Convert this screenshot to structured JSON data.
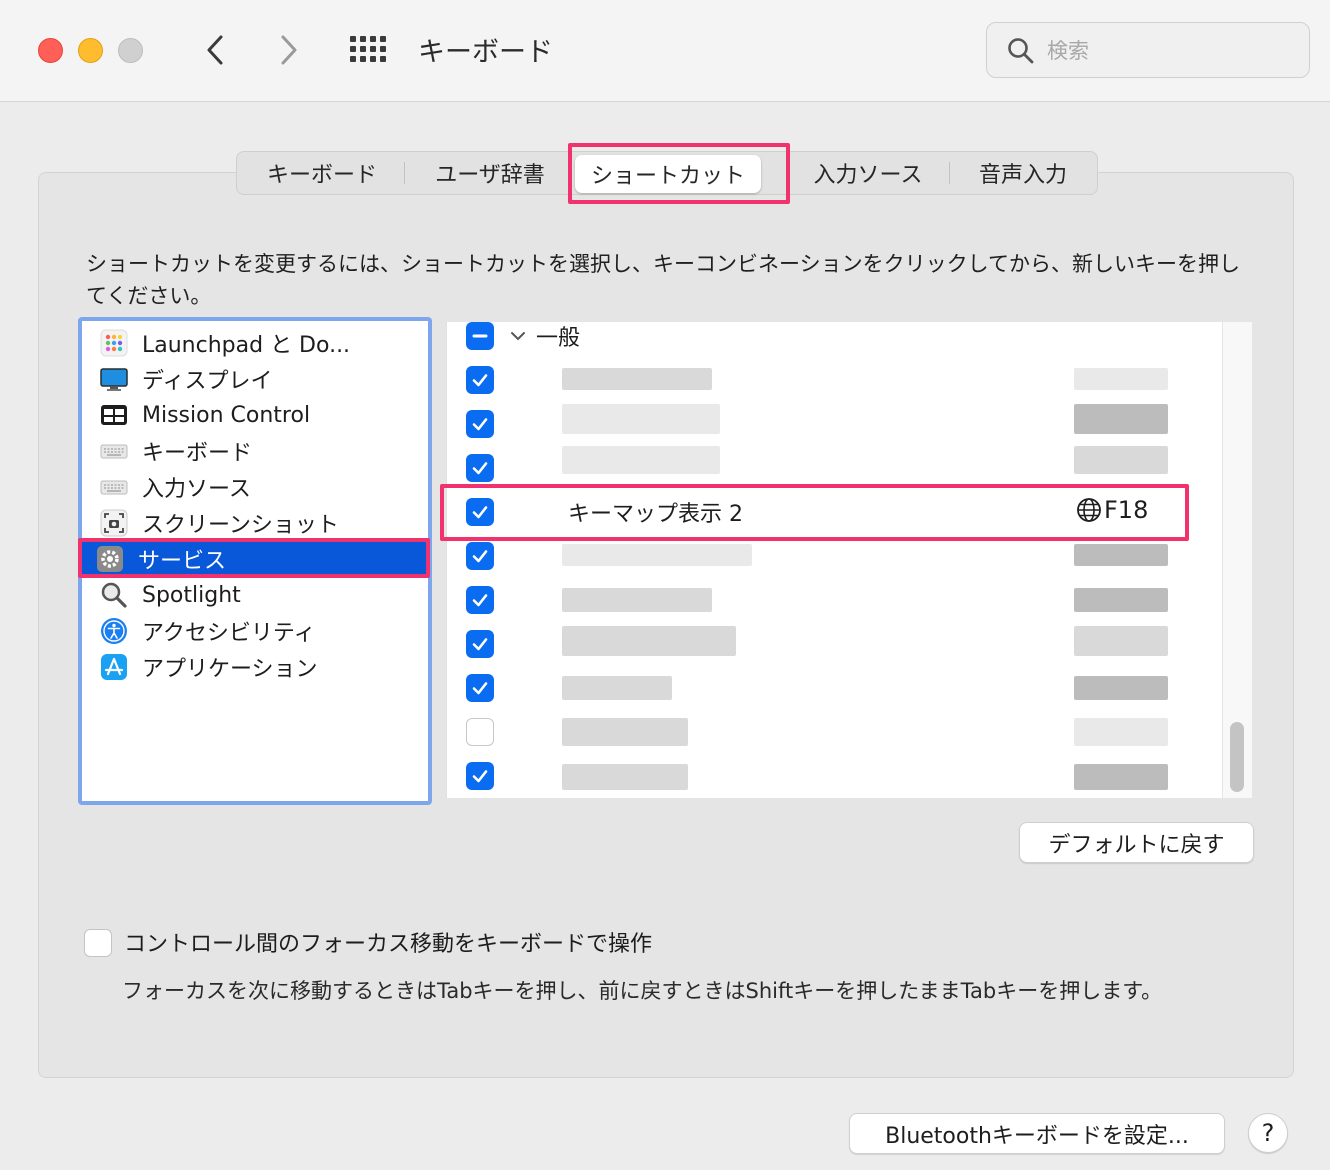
{
  "window": {
    "title": "キーボード"
  },
  "search": {
    "placeholder": "検索"
  },
  "tabs": [
    {
      "label": "キーボード",
      "active": false
    },
    {
      "label": "ユーザ辞書",
      "active": false
    },
    {
      "label": "ショートカット",
      "active": true
    },
    {
      "label": "入力ソース",
      "active": false
    },
    {
      "label": "音声入力",
      "active": false
    }
  ],
  "description": "ショートカットを変更するには、ショートカットを選択し、キーコンビネーションをクリックしてから、新しいキーを押してください。",
  "categories": [
    {
      "label": "Launchpad と Do...",
      "icon": "launchpad-icon",
      "selected": false
    },
    {
      "label": "ディスプレイ",
      "icon": "display-icon",
      "selected": false
    },
    {
      "label": "Mission Control",
      "icon": "mission-control-icon",
      "selected": false
    },
    {
      "label": "キーボード",
      "icon": "keyboard-icon",
      "selected": false
    },
    {
      "label": "入力ソース",
      "icon": "input-source-icon",
      "selected": false
    },
    {
      "label": "スクリーンショット",
      "icon": "screenshot-icon",
      "selected": false
    },
    {
      "label": "サービス",
      "icon": "gear-icon",
      "selected": true
    },
    {
      "label": "Spotlight",
      "icon": "spotlight-icon",
      "selected": false
    },
    {
      "label": "アクセシビリティ",
      "icon": "accessibility-icon",
      "selected": false
    },
    {
      "label": "アプリケーション",
      "icon": "app-store-icon",
      "selected": false
    }
  ],
  "shortcuts": {
    "group_label": "一般",
    "highlighted_row": {
      "label": "キーマップ表示 2",
      "key": "F18",
      "checked": true
    },
    "rows_checked": [
      true,
      true,
      true,
      true,
      true,
      true,
      true,
      true,
      true,
      false,
      true
    ]
  },
  "buttons": {
    "restore_defaults": "デフォルトに戻す",
    "bluetooth": "Bluetoothキーボードを設定...",
    "help": "?"
  },
  "focus": {
    "checkbox_label": "コントロール間のフォーカス移動をキーボードで操作",
    "checked": false,
    "description": "フォーカスを次に移動するときはTabキーを押し、前に戻すときはShiftキーを押したままTabキーを押します。"
  },
  "colors": {
    "accent": "#0a6cf0",
    "selection": "#0958d9",
    "highlight": "#f0336f",
    "focus_ring": "#7ea6ec"
  }
}
